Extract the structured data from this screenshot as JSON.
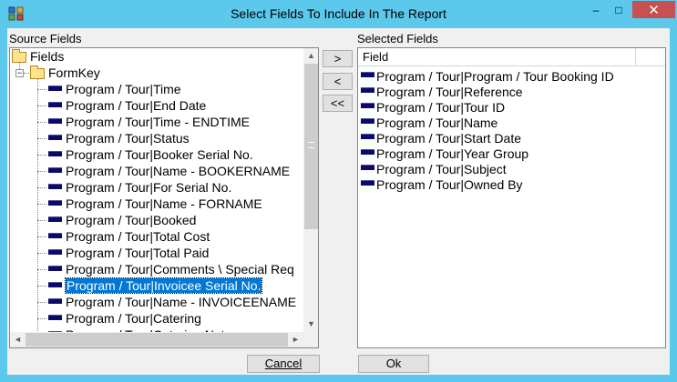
{
  "window": {
    "title": "Select Fields To Include In The Report",
    "app_icon": "report-app-icon",
    "controls": {
      "minimize": "–",
      "maximize": "□",
      "close": "✕"
    }
  },
  "source": {
    "label": "Source Fields",
    "root": "Fields",
    "group": "FormKey",
    "items": [
      "Program / Tour|Time",
      "Program / Tour|End Date",
      "Program / Tour|Time - ENDTIME",
      "Program / Tour|Status",
      "Program / Tour|Booker Serial No.",
      "Program / Tour|Name - BOOKERNAME",
      "Program / Tour|For Serial No.",
      "Program / Tour|Name - FORNAME",
      "Program / Tour|Booked",
      "Program / Tour|Total Cost",
      "Program / Tour|Total Paid",
      "Program / Tour|Comments \\   Special Req",
      "Program / Tour|Invoicee Serial No.",
      "Program / Tour|Name - INVOICEENAME",
      "Program / Tour|Catering",
      "Program / Tour|Catering Notes"
    ],
    "selected_index": 12,
    "expander_root": "−",
    "expander_group": "−",
    "scroll_up": "▲",
    "scroll_down": "▼",
    "scroll_left": "◄",
    "scroll_right": "►"
  },
  "buttons": {
    "add": ">",
    "remove": "<",
    "remove_all": "<<",
    "cancel": "Cancel",
    "ok": "Ok"
  },
  "selected": {
    "label": "Selected Fields",
    "column_header": "Field",
    "items": [
      "Program / Tour|Program / Tour Booking ID",
      "Program / Tour|Reference",
      "Program / Tour|Tour ID",
      "Program / Tour|Name",
      "Program / Tour|Start Date",
      "Program / Tour|Year Group",
      "Program / Tour|Subject",
      "Program / Tour|Owned By"
    ]
  },
  "colors": {
    "titlebar": "#5bc8ec",
    "selection": "#0078d7",
    "field_icon": "#0a0a6a",
    "close_button": "#c75050"
  }
}
